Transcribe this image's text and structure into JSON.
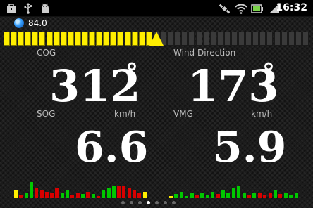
{
  "statusbar": {
    "time": "16:32",
    "icons_left": [
      "briefcase-icon",
      "usb-icon",
      "android-debug-icon"
    ],
    "icons_right": [
      "gps-icon",
      "wifi-icon",
      "battery-icon",
      "signal-icon"
    ]
  },
  "gps": {
    "value": "84.0"
  },
  "gauge": {
    "segments_total": 43,
    "segments_lit": 21,
    "accent": "#ffee00"
  },
  "metrics": {
    "cog": {
      "label": "COG",
      "value": "312",
      "unit_symbol": "°"
    },
    "wind": {
      "label": "Wind Direction",
      "value": "173",
      "unit_symbol": "°"
    },
    "sog": {
      "label": "SOG",
      "unit": "km/h",
      "value": "6.6"
    },
    "vmg": {
      "label": "VMG",
      "unit": "km/h",
      "value": "5.9"
    }
  },
  "history_left": [
    {
      "v": 0.35,
      "c": "#ffee00"
    },
    {
      "v": 0.15,
      "c": "#d80000"
    },
    {
      "v": 0.25,
      "c": "#00c800"
    },
    {
      "v": 0.75,
      "c": "#00c800"
    },
    {
      "v": 0.45,
      "c": "#d80000"
    },
    {
      "v": 0.35,
      "c": "#d80000"
    },
    {
      "v": 0.3,
      "c": "#d80000"
    },
    {
      "v": 0.25,
      "c": "#d80000"
    },
    {
      "v": 0.45,
      "c": "#d80000"
    },
    {
      "v": 0.25,
      "c": "#00c800"
    },
    {
      "v": 0.4,
      "c": "#00c800"
    },
    {
      "v": 0.15,
      "c": "#d80000"
    },
    {
      "v": 0.25,
      "c": "#d80000"
    },
    {
      "v": 0.2,
      "c": "#00c800"
    },
    {
      "v": 0.3,
      "c": "#d80000"
    },
    {
      "v": 0.2,
      "c": "#00c800"
    },
    {
      "v": 0.1,
      "c": "#d80000"
    },
    {
      "v": 0.35,
      "c": "#00c800"
    },
    {
      "v": 0.45,
      "c": "#00c800"
    },
    {
      "v": 0.55,
      "c": "#00c800"
    },
    {
      "v": 0.55,
      "c": "#d80000"
    },
    {
      "v": 0.6,
      "c": "#d80000"
    },
    {
      "v": 0.45,
      "c": "#d80000"
    },
    {
      "v": 0.35,
      "c": "#d80000"
    },
    {
      "v": 0.25,
      "c": "#d80000"
    },
    {
      "v": 0.3,
      "c": "#ffee00"
    }
  ],
  "history_right": [
    {
      "v": 0.1,
      "c": "#ffee00"
    },
    {
      "v": 0.2,
      "c": "#00c800"
    },
    {
      "v": 0.3,
      "c": "#00c800"
    },
    {
      "v": 0.1,
      "c": "#00c800"
    },
    {
      "v": 0.25,
      "c": "#00c800"
    },
    {
      "v": 0.15,
      "c": "#d80000"
    },
    {
      "v": 0.25,
      "c": "#00c800"
    },
    {
      "v": 0.15,
      "c": "#00c800"
    },
    {
      "v": 0.3,
      "c": "#00c800"
    },
    {
      "v": 0.2,
      "c": "#d80000"
    },
    {
      "v": 0.35,
      "c": "#00c800"
    },
    {
      "v": 0.25,
      "c": "#00c800"
    },
    {
      "v": 0.45,
      "c": "#00c800"
    },
    {
      "v": 0.55,
      "c": "#00c800"
    },
    {
      "v": 0.25,
      "c": "#00c800"
    },
    {
      "v": 0.15,
      "c": "#d80000"
    },
    {
      "v": 0.25,
      "c": "#00c800"
    },
    {
      "v": 0.25,
      "c": "#d80000"
    },
    {
      "v": 0.15,
      "c": "#d80000"
    },
    {
      "v": 0.25,
      "c": "#d80000"
    },
    {
      "v": 0.35,
      "c": "#00c800"
    },
    {
      "v": 0.2,
      "c": "#d80000"
    },
    {
      "v": 0.25,
      "c": "#00c800"
    },
    {
      "v": 0.15,
      "c": "#00c800"
    },
    {
      "v": 0.25,
      "c": "#00c800"
    }
  ],
  "pager": {
    "count": 7,
    "active_index": 3
  }
}
